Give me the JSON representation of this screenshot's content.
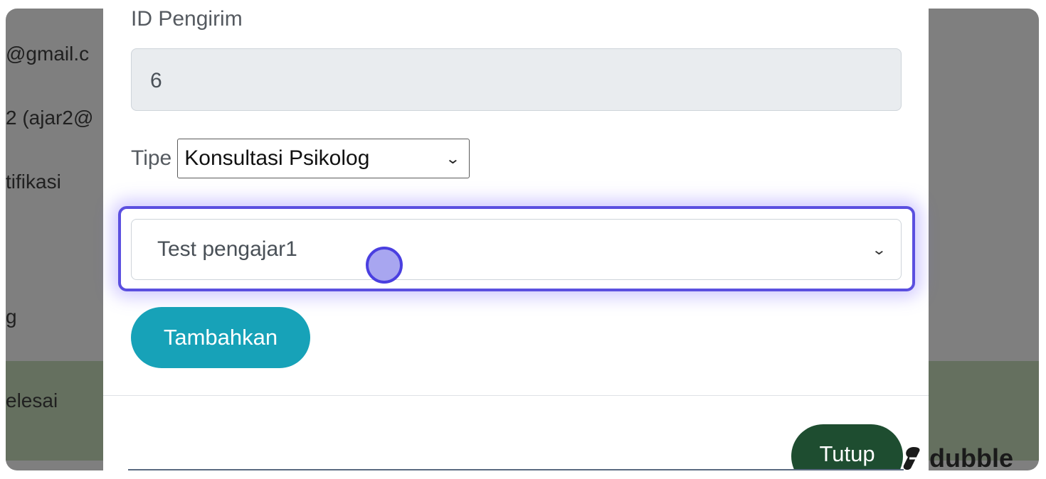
{
  "backdrop": {
    "line1": "@gmail.c",
    "line2": "2 (ajar2@",
    "line3": "tifikasi",
    "line4": "g",
    "line5": "elesai"
  },
  "modal": {
    "id_label": "ID Pengirim",
    "id_value": "6",
    "type_label": "Tipe",
    "type_selected": "Konsultasi Psikolog",
    "teacher_selected": "Test pengajar1",
    "add_button": "Tambahkan",
    "close_button": "Tutup"
  },
  "watermark": {
    "text": "dubble"
  },
  "colors": {
    "focus_ring": "#5b4fe0",
    "add_button": "#17a2b8",
    "close_button": "#1e4d30"
  }
}
